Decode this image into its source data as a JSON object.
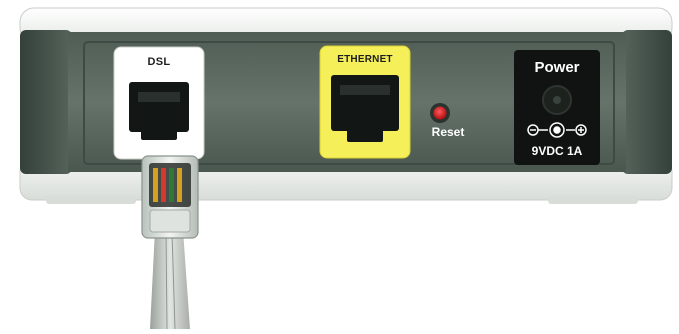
{
  "device": {
    "ports": {
      "dsl": {
        "label": "DSL"
      },
      "ethernet": {
        "label": "ETHERNET",
        "accent_color": "#f5ef5a"
      },
      "reset": {
        "label": "Reset",
        "button_color": "#d21a22"
      },
      "power": {
        "label": "Power",
        "rating": "9VDC 1A"
      }
    },
    "colors": {
      "housing": "#eef1ee",
      "panel": "#5b6a60",
      "panel_dark": "#3d4a42"
    }
  }
}
